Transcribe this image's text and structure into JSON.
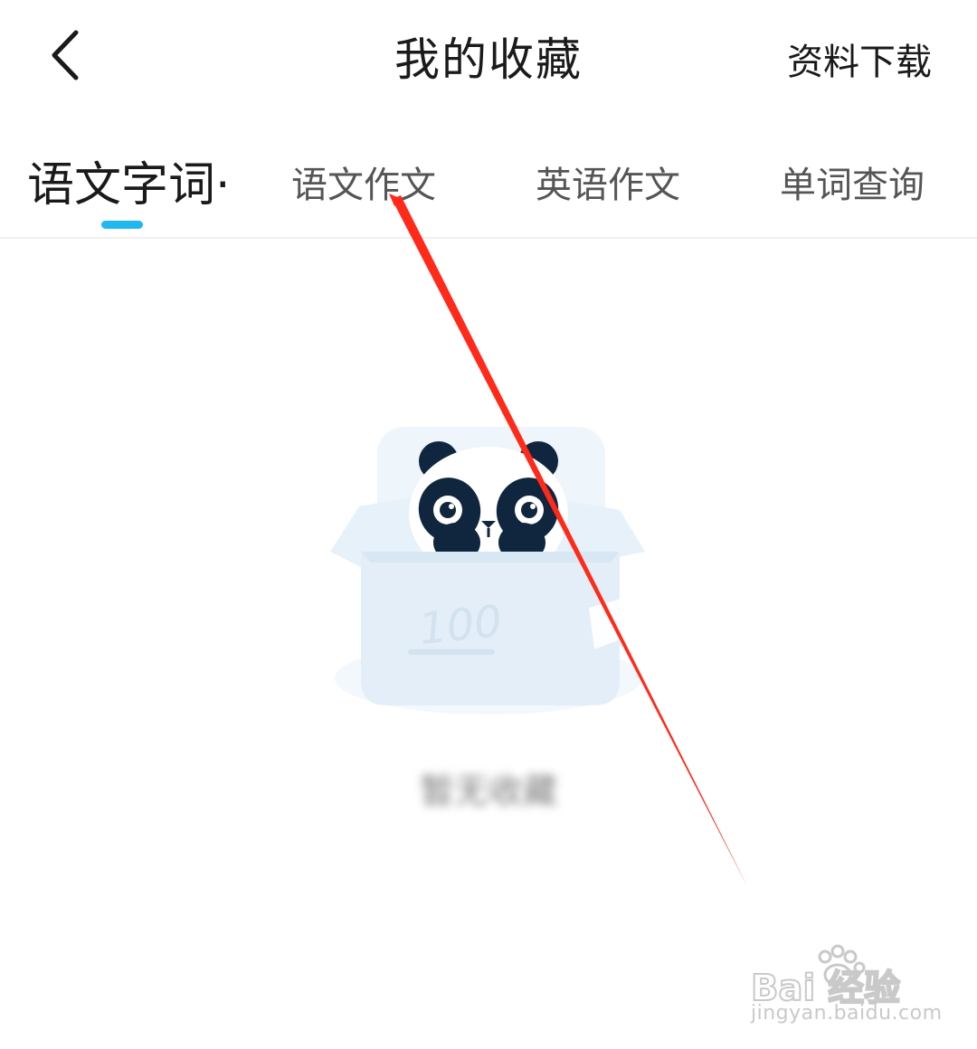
{
  "header": {
    "title": "我的收藏",
    "action_label": "资料下载"
  },
  "tabs": [
    {
      "label": "语文字词·",
      "active": true
    },
    {
      "label": "语文作文",
      "active": false
    },
    {
      "label": "英语作文",
      "active": false
    },
    {
      "label": "单词查询",
      "active": false
    }
  ],
  "illustration": {
    "box_label": "100"
  },
  "empty_state": {
    "text": "暂无收藏"
  },
  "watermark": {
    "brand": "Bai 经验",
    "url": "jingyan.baidu.com"
  },
  "colors": {
    "accent": "#21b7f0",
    "annotation_arrow": "#ff2a1a"
  }
}
